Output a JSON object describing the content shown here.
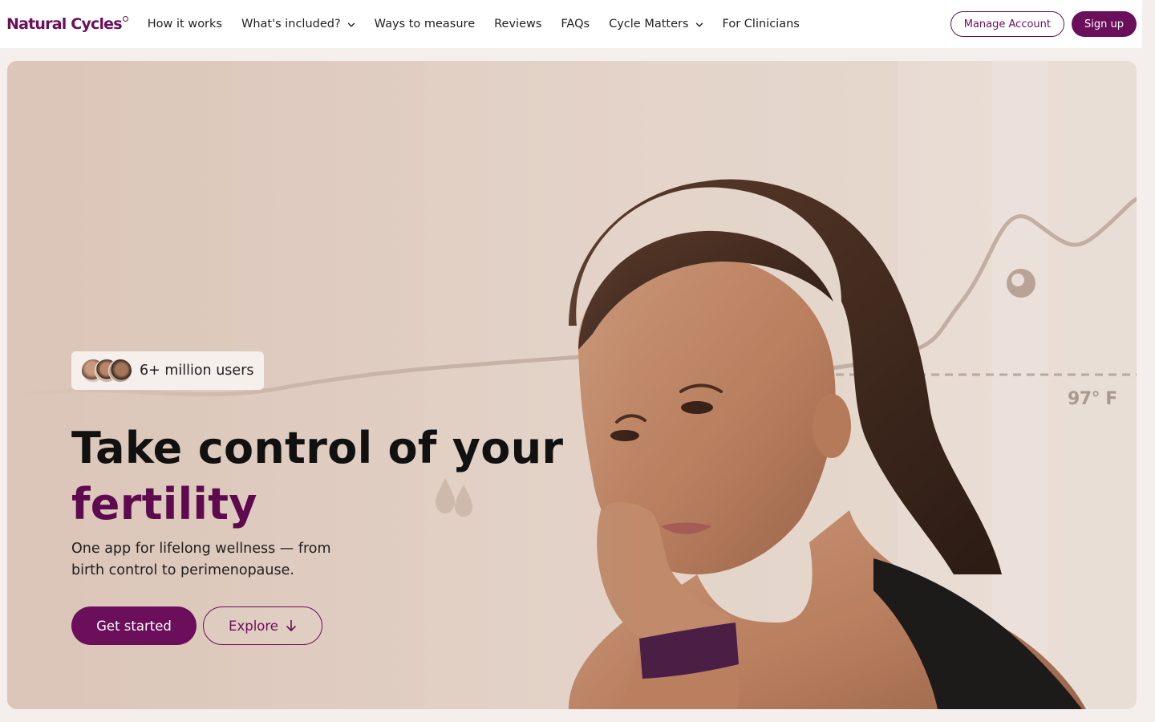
{
  "header": {
    "logo": "Natural Cycles",
    "nav": [
      {
        "label": "How it works",
        "has_dropdown": false
      },
      {
        "label": "What's included?",
        "has_dropdown": true
      },
      {
        "label": "Ways to measure",
        "has_dropdown": false
      },
      {
        "label": "Reviews",
        "has_dropdown": false
      },
      {
        "label": "FAQs",
        "has_dropdown": false
      },
      {
        "label": "Cycle Matters",
        "has_dropdown": true
      },
      {
        "label": "For Clinicians",
        "has_dropdown": false
      }
    ],
    "manage_account": "Manage Account",
    "sign_up": "Sign up"
  },
  "hero": {
    "users_badge": "6+ million users",
    "headline_line1": "Take control of your",
    "headline_accent": "fertility",
    "subtext": "One app for lifelong wellness — from birth control to perimenopause.",
    "cta_primary": "Get started",
    "cta_secondary": "Explore",
    "temperature_label": "97° F"
  },
  "colors": {
    "brand": "#6b0f5b",
    "accent_text": "#5d0a4e",
    "hero_bg": "#e1cfc4"
  },
  "icons": [
    "chevron-down-icon",
    "arrow-down-icon",
    "water-drop-icon",
    "chart-point-icon"
  ]
}
